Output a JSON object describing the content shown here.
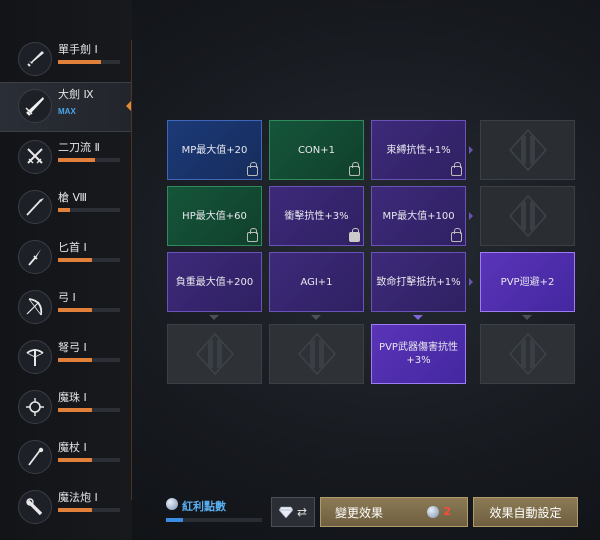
{
  "weapons": [
    {
      "name": "單手劍 Ⅰ",
      "icon": "one-hand-sword-icon",
      "progress": 0.7,
      "selected": false
    },
    {
      "name": "大劍 Ⅸ",
      "icon": "greatsword-icon",
      "max_label": "MAX",
      "selected": true
    },
    {
      "name": "二刀流 Ⅱ",
      "icon": "dual-blades-icon",
      "progress": 0.6,
      "selected": false
    },
    {
      "name": "槍 Ⅷ",
      "icon": "spear-icon",
      "progress": 0.2,
      "selected": false
    },
    {
      "name": "匕首 Ⅰ",
      "icon": "dagger-icon",
      "progress": 0.55,
      "selected": false
    },
    {
      "name": "弓 Ⅰ",
      "icon": "bow-icon",
      "progress": 0.55,
      "selected": false
    },
    {
      "name": "弩弓 Ⅰ",
      "icon": "crossbow-icon",
      "progress": 0.55,
      "selected": false
    },
    {
      "name": "魔珠 Ⅰ",
      "icon": "orb-icon",
      "progress": 0.55,
      "selected": false
    },
    {
      "name": "魔杖 Ⅰ",
      "icon": "wand-icon",
      "progress": 0.55,
      "selected": false
    },
    {
      "name": "魔法炮 Ⅰ",
      "icon": "magic-cannon-icon",
      "progress": 0.55,
      "selected": false
    }
  ],
  "grid": [
    [
      {
        "text": "MP最大值+20",
        "style": "blue",
        "lock": "open"
      },
      {
        "text": "CON+1",
        "style": "green",
        "lock": "open"
      },
      {
        "text": "束縛抗性+1%",
        "style": "purple",
        "lock": "open"
      },
      {
        "text": "",
        "style": "locked",
        "lock": "none"
      }
    ],
    [
      {
        "text": "HP最大值+60",
        "style": "green",
        "lock": "open"
      },
      {
        "text": "衝擊抗性+3%",
        "style": "purple",
        "lock": "closed"
      },
      {
        "text": "MP最大值+100",
        "style": "purple",
        "lock": "open"
      },
      {
        "text": "",
        "style": "locked",
        "lock": "none"
      }
    ],
    [
      {
        "text": "負重最大值+200",
        "style": "purple",
        "lock": "none"
      },
      {
        "text": "AGI+1",
        "style": "purple",
        "lock": "none"
      },
      {
        "text": "致命打擊抵抗+1%",
        "style": "purple",
        "lock": "none"
      },
      {
        "text": "PVP迴避+2",
        "style": "purple-hi",
        "lock": "none"
      }
    ],
    [
      {
        "text": "",
        "style": "locked-dark",
        "lock": "none"
      },
      {
        "text": "",
        "style": "locked-dark",
        "lock": "none"
      },
      {
        "text": "PVP武器傷害抗性+3%",
        "style": "purple-hi",
        "lock": "none"
      },
      {
        "text": "",
        "style": "locked-dark",
        "lock": "none"
      }
    ]
  ],
  "bottom": {
    "points_label": "紅利點數",
    "points_progress": 0.18,
    "swap_arrows": "⇄",
    "change_label": "變更效果",
    "change_cost": "2",
    "auto_label": "效果自動設定"
  },
  "colors": {
    "accent_orange": "#e0803a",
    "max_blue": "#4aa6e8",
    "cost_red": "#ff4a3a",
    "gold_button": "#8c7a55"
  }
}
